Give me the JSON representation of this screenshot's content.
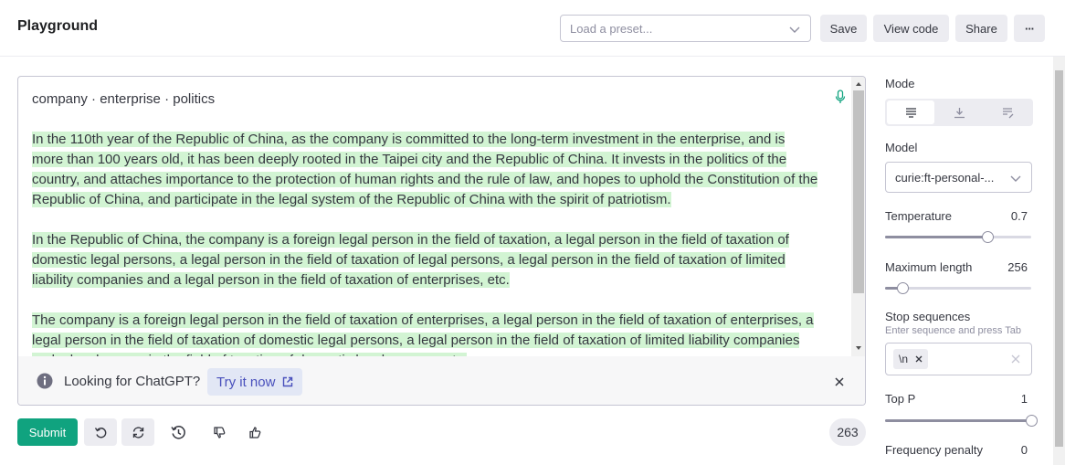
{
  "header": {
    "title": "Playground",
    "preset_placeholder": "Load a preset...",
    "save_label": "Save",
    "view_code_label": "View code",
    "share_label": "Share",
    "more_label": "···"
  },
  "editor": {
    "tags": "company · enterprise · politics",
    "paragraphs": [
      "In the 110th year of the Republic of China, as the company is committed to the long-term investment in the enterprise, and is more than 100 years old, it has been deeply rooted in the Taipei city and the Republic of China. It invests in the politics of the country, and attaches importance to the protection of human rights and the rule of law, and hopes to uphold the Constitution of the Republic of China, and participate in the legal system of the Republic of China with the spirit of patriotism.",
      "In the Republic of China, the company is a foreign legal person in the field of taxation, a legal person in the field of taxation of domestic legal persons, a legal person in the field of taxation of legal persons, a legal person in the field of taxation of limited liability companies and a legal person in the field of taxation of enterprises, etc.",
      "The company is a foreign legal person in the field of taxation of enterprises, a legal person in the field of taxation of enterprises, a legal person in the field of taxation of domestic legal persons, a legal person in the field of taxation of limited liability companies and a legal person in the field of taxation of domestic legal persons, etc."
    ],
    "highlight_color": "#d2f4d3"
  },
  "banner": {
    "text": "Looking for ChatGPT?",
    "link_label": "Try it now"
  },
  "bottom": {
    "submit_label": "Submit",
    "token_count": "263"
  },
  "panel": {
    "mode_label": "Mode",
    "model_label": "Model",
    "model_value": "curie:ft-personal-...",
    "temperature_label": "Temperature",
    "temperature_value": "0.7",
    "temperature_level": 0.7,
    "max_length_label": "Maximum length",
    "max_length_value": "256",
    "max_length_level": 0.12,
    "stop_label": "Stop sequences",
    "stop_hint": "Enter sequence and press Tab",
    "stop_chip": "\\n",
    "top_p_label": "Top P",
    "top_p_value": "1",
    "top_p_level": 1.0,
    "freq_label": "Frequency penalty",
    "freq_value": "0"
  },
  "colors": {
    "accent": "#10a37f",
    "link": "#4950bc",
    "button_bg": "#ececf1"
  }
}
